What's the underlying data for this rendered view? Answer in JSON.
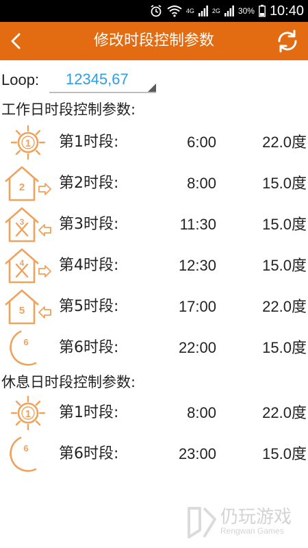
{
  "status_bar": {
    "battery": "30%",
    "time": "10:40",
    "net1": "4G",
    "net2": "4G",
    "net3": "2G"
  },
  "nav": {
    "title": "修改时段控制参数"
  },
  "loop": {
    "label": "Loop:",
    "value": "12345,67"
  },
  "workday": {
    "title": "工作日时段控制参数:",
    "rows": [
      {
        "label": "第1时段:",
        "time": "6:00",
        "temp": "22.0度",
        "icon": "sun-1-icon"
      },
      {
        "label": "第2时段:",
        "time": "8:00",
        "temp": "15.0度",
        "icon": "house-leave-2-icon"
      },
      {
        "label": "第3时段:",
        "time": "11:30",
        "temp": "15.0度",
        "icon": "house-return-meal-3-icon"
      },
      {
        "label": "第4时段:",
        "time": "12:30",
        "temp": "15.0度",
        "icon": "house-leave-meal-4-icon"
      },
      {
        "label": "第5时段:",
        "time": "17:00",
        "temp": "22.0度",
        "icon": "house-return-5-icon"
      },
      {
        "label": "第6时段:",
        "time": "22:00",
        "temp": "15.0度",
        "icon": "moon-6-icon"
      }
    ]
  },
  "restday": {
    "title": "休息日时段控制参数:",
    "rows": [
      {
        "label": "第1时段:",
        "time": "8:00",
        "temp": "22.0度",
        "icon": "sun-1-icon"
      },
      {
        "label": "第6时段:",
        "time": "23:00",
        "temp": "15.0度",
        "icon": "moon-6-icon"
      }
    ]
  },
  "watermark": {
    "text": "仍玩游戏",
    "sub": "Rengwan Games"
  },
  "colors": {
    "accent": "#e36b11",
    "icon_orange": "#f0a15a",
    "loop_value": "#2a9ee6"
  }
}
